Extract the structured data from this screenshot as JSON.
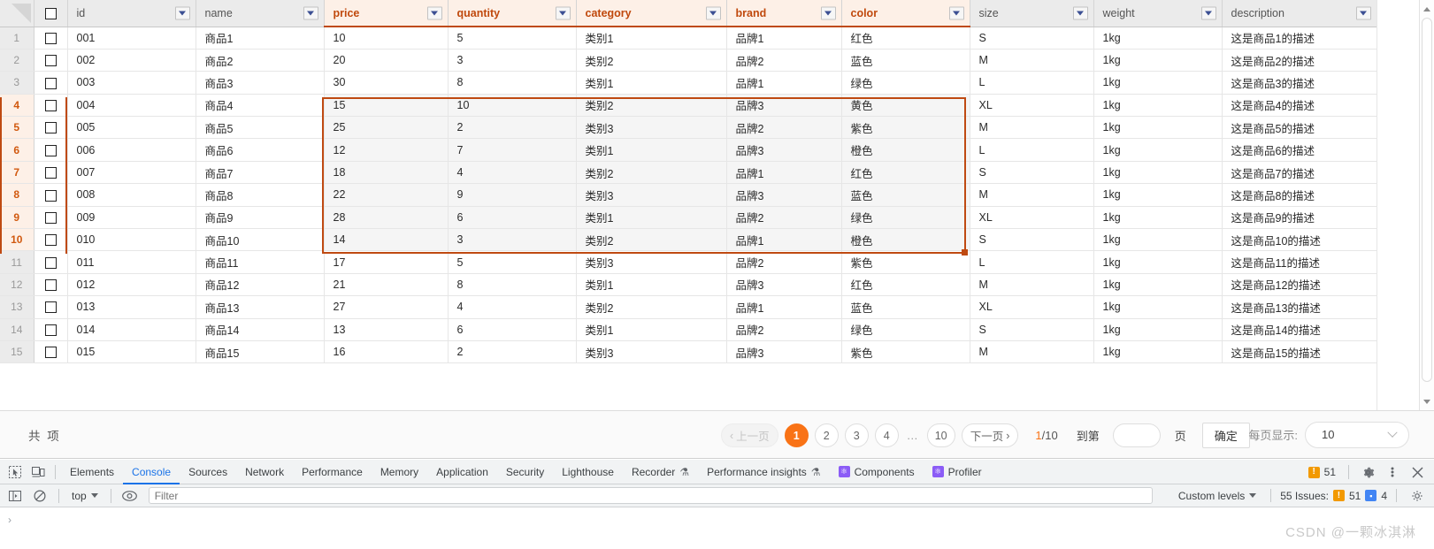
{
  "table": {
    "columns": [
      {
        "key": "id",
        "label": "id",
        "highlight": false
      },
      {
        "key": "name",
        "label": "name",
        "highlight": false
      },
      {
        "key": "price",
        "label": "price",
        "highlight": true
      },
      {
        "key": "quantity",
        "label": "quantity",
        "highlight": true
      },
      {
        "key": "category",
        "label": "category",
        "highlight": true
      },
      {
        "key": "brand",
        "label": "brand",
        "highlight": true
      },
      {
        "key": "color",
        "label": "color",
        "highlight": true
      },
      {
        "key": "size",
        "label": "size",
        "highlight": false
      },
      {
        "key": "weight",
        "label": "weight",
        "highlight": false
      },
      {
        "key": "description",
        "label": "description",
        "highlight": false
      }
    ],
    "rows": [
      {
        "n": "1",
        "id": "001",
        "name": "商品1",
        "price": "10",
        "quantity": "5",
        "category": "类别1",
        "brand": "品牌1",
        "color": "红色",
        "size": "S",
        "weight": "1kg",
        "description": "这是商品1的描述"
      },
      {
        "n": "2",
        "id": "002",
        "name": "商品2",
        "price": "20",
        "quantity": "3",
        "category": "类别2",
        "brand": "品牌2",
        "color": "蓝色",
        "size": "M",
        "weight": "1kg",
        "description": "这是商品2的描述"
      },
      {
        "n": "3",
        "id": "003",
        "name": "商品3",
        "price": "30",
        "quantity": "8",
        "category": "类别1",
        "brand": "品牌1",
        "color": "绿色",
        "size": "L",
        "weight": "1kg",
        "description": "这是商品3的描述"
      },
      {
        "n": "4",
        "id": "004",
        "name": "商品4",
        "price": "15",
        "quantity": "10",
        "category": "类别2",
        "brand": "品牌3",
        "color": "黄色",
        "size": "XL",
        "weight": "1kg",
        "description": "这是商品4的描述"
      },
      {
        "n": "5",
        "id": "005",
        "name": "商品5",
        "price": "25",
        "quantity": "2",
        "category": "类别3",
        "brand": "品牌2",
        "color": "紫色",
        "size": "M",
        "weight": "1kg",
        "description": "这是商品5的描述"
      },
      {
        "n": "6",
        "id": "006",
        "name": "商品6",
        "price": "12",
        "quantity": "7",
        "category": "类别1",
        "brand": "品牌3",
        "color": "橙色",
        "size": "L",
        "weight": "1kg",
        "description": "这是商品6的描述"
      },
      {
        "n": "7",
        "id": "007",
        "name": "商品7",
        "price": "18",
        "quantity": "4",
        "category": "类别2",
        "brand": "品牌1",
        "color": "红色",
        "size": "S",
        "weight": "1kg",
        "description": "这是商品7的描述"
      },
      {
        "n": "8",
        "id": "008",
        "name": "商品8",
        "price": "22",
        "quantity": "9",
        "category": "类别3",
        "brand": "品牌3",
        "color": "蓝色",
        "size": "M",
        "weight": "1kg",
        "description": "这是商品8的描述"
      },
      {
        "n": "9",
        "id": "009",
        "name": "商品9",
        "price": "28",
        "quantity": "6",
        "category": "类别1",
        "brand": "品牌2",
        "color": "绿色",
        "size": "XL",
        "weight": "1kg",
        "description": "这是商品9的描述"
      },
      {
        "n": "10",
        "id": "010",
        "name": "商品10",
        "price": "14",
        "quantity": "3",
        "category": "类别2",
        "brand": "品牌1",
        "color": "橙色",
        "size": "S",
        "weight": "1kg",
        "description": "这是商品10的描述"
      },
      {
        "n": "11",
        "id": "011",
        "name": "商品11",
        "price": "17",
        "quantity": "5",
        "category": "类别3",
        "brand": "品牌2",
        "color": "紫色",
        "size": "L",
        "weight": "1kg",
        "description": "这是商品11的描述"
      },
      {
        "n": "12",
        "id": "012",
        "name": "商品12",
        "price": "21",
        "quantity": "8",
        "category": "类别1",
        "brand": "品牌3",
        "color": "红色",
        "size": "M",
        "weight": "1kg",
        "description": "这是商品12的描述"
      },
      {
        "n": "13",
        "id": "013",
        "name": "商品13",
        "price": "27",
        "quantity": "4",
        "category": "类别2",
        "brand": "品牌1",
        "color": "蓝色",
        "size": "XL",
        "weight": "1kg",
        "description": "这是商品13的描述"
      },
      {
        "n": "14",
        "id": "014",
        "name": "商品14",
        "price": "13",
        "quantity": "6",
        "category": "类别1",
        "brand": "品牌2",
        "color": "绿色",
        "size": "S",
        "weight": "1kg",
        "description": "这是商品14的描述"
      },
      {
        "n": "15",
        "id": "015",
        "name": "商品15",
        "price": "16",
        "quantity": "2",
        "category": "类别3",
        "brand": "品牌3",
        "color": "紫色",
        "size": "M",
        "weight": "1kg",
        "description": "这是商品15的描述"
      }
    ],
    "selection": {
      "first_row": 4,
      "last_row": 10,
      "first_col": "price",
      "last_col": "color"
    },
    "colors": {
      "accent": "#bf4a12",
      "header_highlight_bg": "#fdf0e7",
      "header_bg": "#ebebeb"
    }
  },
  "pager": {
    "total_prefix": "共",
    "total_suffix": "项",
    "total_count": "",
    "prev_label": "上一页",
    "next_label": "下一页",
    "pages": [
      "1",
      "2",
      "3",
      "4"
    ],
    "ellipsis": "…",
    "last_page": "10",
    "current_page": "1",
    "page_fraction_current": "1",
    "page_fraction_rest": "/10",
    "jump_label": "到第",
    "jump_value": "",
    "jump_unit": "页",
    "confirm_label": "确定",
    "per_page_label": "每页显示:",
    "per_page_value": "10",
    "accent": "#f97316"
  },
  "devtools": {
    "tabs": [
      {
        "label": "Elements",
        "active": false,
        "icon": ""
      },
      {
        "label": "Console",
        "active": true,
        "icon": ""
      },
      {
        "label": "Sources",
        "active": false,
        "icon": ""
      },
      {
        "label": "Network",
        "active": false,
        "icon": ""
      },
      {
        "label": "Performance",
        "active": false,
        "icon": ""
      },
      {
        "label": "Memory",
        "active": false,
        "icon": ""
      },
      {
        "label": "Application",
        "active": false,
        "icon": ""
      },
      {
        "label": "Security",
        "active": false,
        "icon": ""
      },
      {
        "label": "Lighthouse",
        "active": false,
        "icon": ""
      },
      {
        "label": "Recorder",
        "active": false,
        "icon": "flask"
      },
      {
        "label": "Performance insights",
        "active": false,
        "icon": "flask"
      },
      {
        "label": "Components",
        "active": false,
        "icon": "react"
      },
      {
        "label": "Profiler",
        "active": false,
        "icon": "react"
      }
    ],
    "warning_count": "51",
    "console": {
      "context_label": "top",
      "filter_placeholder": "Filter",
      "levels_label": "Custom levels",
      "issues_label": "55 Issues:",
      "issues_warnings": "51",
      "issues_messages": "4"
    }
  },
  "watermark": "CSDN @一颗冰淇淋"
}
